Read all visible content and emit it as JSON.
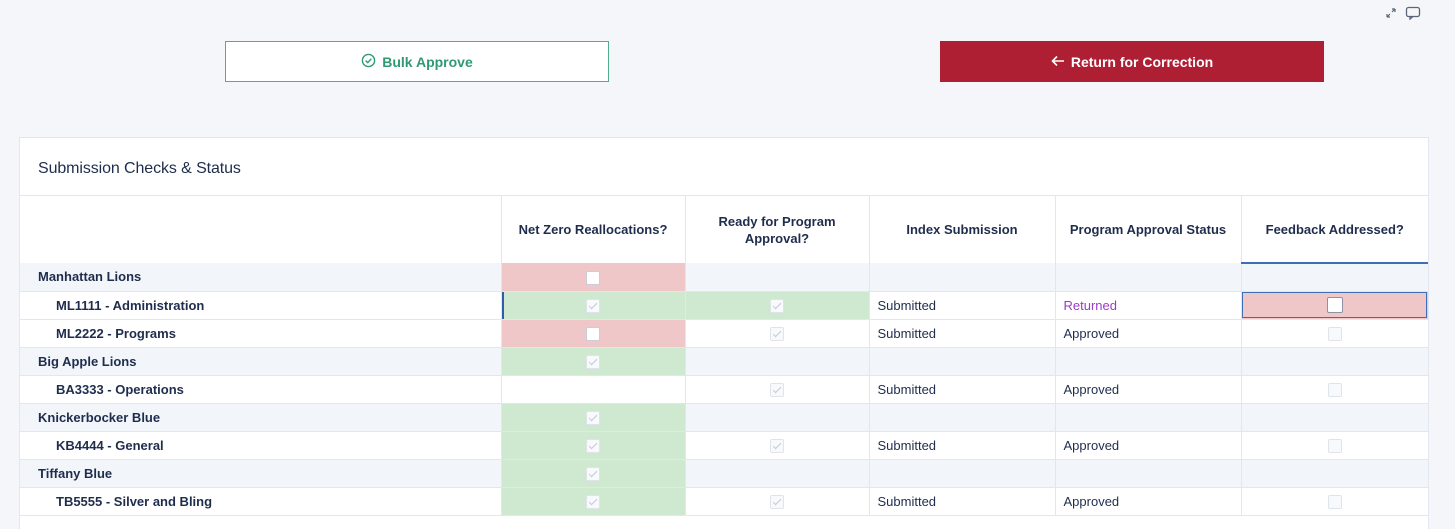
{
  "toolbar": {
    "bulk_approve_label": "Bulk Approve",
    "return_label": "Return for Correction",
    "approve_color": "#2f9a72",
    "return_color": "#ae1f33"
  },
  "card": {
    "title": "Submission Checks & Status"
  },
  "table": {
    "columns": [
      "",
      "Net Zero Reallocations?",
      "Ready for Program Approval?",
      "Index Submission",
      "Program Approval Status",
      "Feedback Addressed?"
    ],
    "rows": [
      {
        "name": "Manhattan Lions",
        "type": "group",
        "net_zero": "unchecked",
        "ready": "",
        "index": "",
        "status": "",
        "feedback": ""
      },
      {
        "name": "ML1111 - Administration",
        "type": "child",
        "net_zero": "checked",
        "ready": "checked",
        "index": "Submitted",
        "status": "Returned",
        "feedback": "unchecked"
      },
      {
        "name": "ML2222 - Programs",
        "type": "child",
        "net_zero": "unchecked",
        "ready": "checked",
        "index": "Submitted",
        "status": "Approved",
        "feedback": "disabled"
      },
      {
        "name": "Big Apple Lions",
        "type": "group",
        "net_zero": "checked",
        "ready": "",
        "index": "",
        "status": "",
        "feedback": ""
      },
      {
        "name": "BA3333 - Operations",
        "type": "child",
        "net_zero": "",
        "ready": "checked",
        "index": "Submitted",
        "status": "Approved",
        "feedback": "disabled"
      },
      {
        "name": "Knickerbocker Blue",
        "type": "group",
        "net_zero": "checked",
        "ready": "",
        "index": "",
        "status": "",
        "feedback": ""
      },
      {
        "name": "KB4444 - General",
        "type": "child",
        "net_zero": "checked",
        "ready": "checked",
        "index": "Submitted",
        "status": "Approved",
        "feedback": "disabled"
      },
      {
        "name": "Tiffany Blue",
        "type": "group",
        "net_zero": "checked",
        "ready": "",
        "index": "",
        "status": "",
        "feedback": ""
      },
      {
        "name": "TB5555 - Silver and Bling",
        "type": "child",
        "net_zero": "checked",
        "ready": "checked",
        "index": "Submitted",
        "status": "Approved",
        "feedback": "disabled"
      }
    ]
  },
  "colors": {
    "fail_bg": "#f0c7c9",
    "pass_bg": "#cfe9d1",
    "returned_text": "#9b3cc6"
  }
}
